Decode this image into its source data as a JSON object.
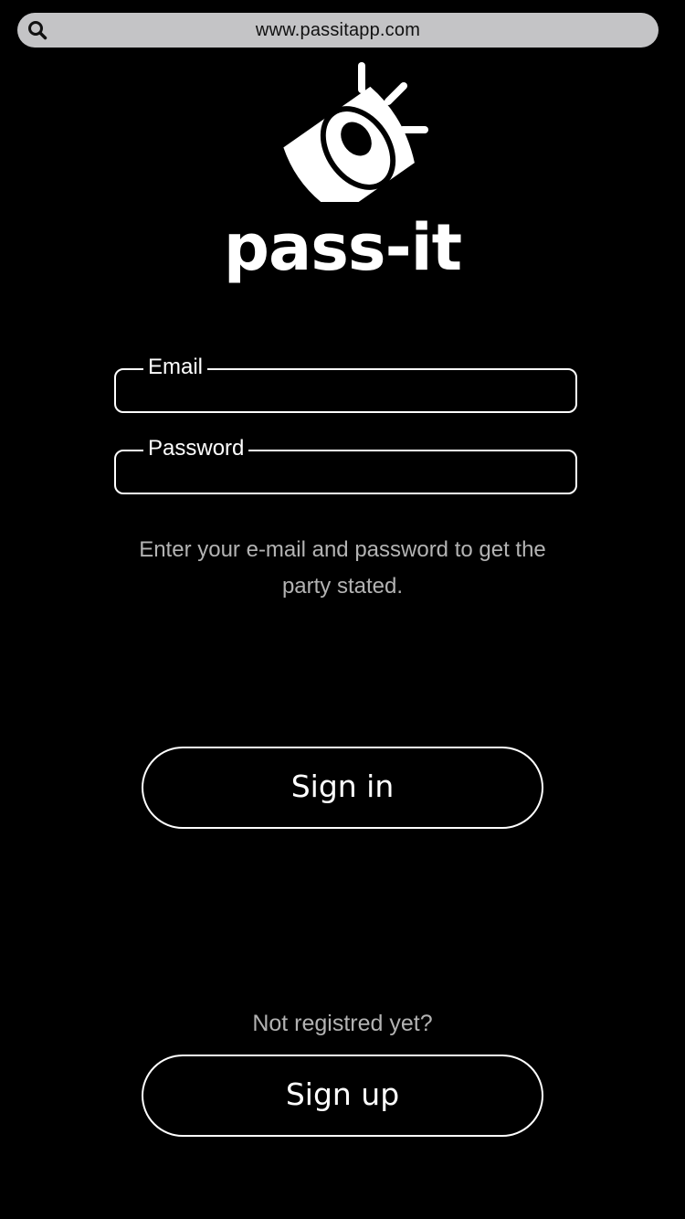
{
  "browser": {
    "url": "www.passitapp.com",
    "search_icon": "search-icon"
  },
  "logo": {
    "icon": "speaker-icon",
    "text": "pass-it"
  },
  "form": {
    "email_label": "Email",
    "email_value": "",
    "password_label": "Password",
    "password_value": "",
    "hint": "Enter your e-mail and password to get the party stated."
  },
  "actions": {
    "signin_label": "Sign in",
    "not_registered": "Not registred yet?",
    "signup_label": "Sign up"
  },
  "colors": {
    "background": "#000000",
    "foreground": "#ffffff",
    "url_bar": "#c4c4c6",
    "muted_text": "#b3b3b3"
  }
}
